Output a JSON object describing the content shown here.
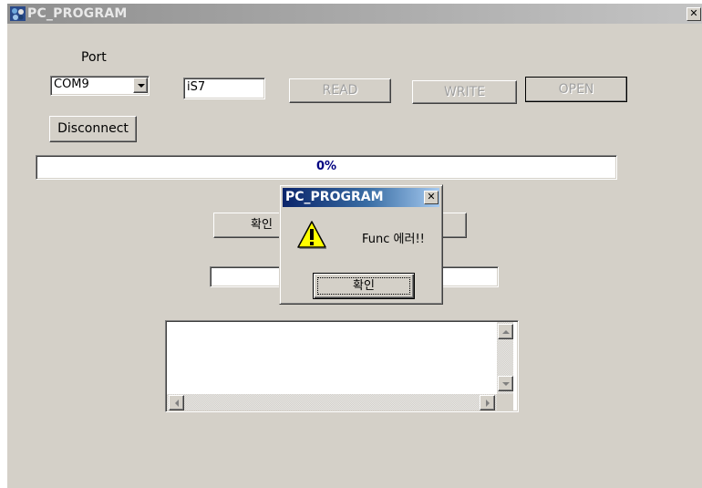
{
  "window": {
    "title": "PC_PROGRAM",
    "close_glyph": "✕"
  },
  "port": {
    "label": "Port",
    "selected": "COM9"
  },
  "device_field": {
    "value": "iS7"
  },
  "buttons": {
    "read": "READ",
    "write": "WRITE",
    "open": "OPEN",
    "disconnect": "Disconnect",
    "confirm": "확인"
  },
  "progress": {
    "text": "0%",
    "value": 0
  },
  "dialog": {
    "title": "PC_PROGRAM",
    "close_glyph": "✕",
    "message": "Func 에러!!",
    "ok_label": "확인",
    "icon": "warning-icon"
  },
  "colors": {
    "face": "#d4d0c8",
    "progress_text": "#000080",
    "dialog_title_start": "#0a246a",
    "dialog_title_end": "#a6caf0"
  }
}
